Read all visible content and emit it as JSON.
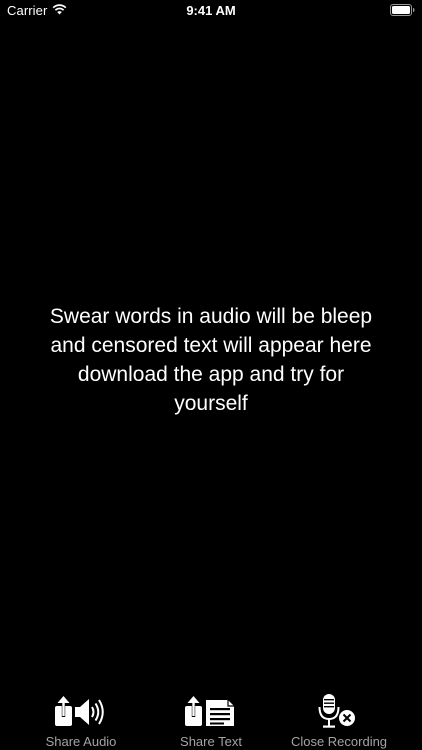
{
  "status_bar": {
    "carrier": "Carrier",
    "time": "9:41 AM",
    "wifi_icon": "wifi-icon",
    "battery_icon": "battery-full-icon"
  },
  "main": {
    "message": "Swear words in audio will be bleep\nand censored text will appear here\ndownload the app and try for\nyourself"
  },
  "toolbar": {
    "share_audio": {
      "label": "Share Audio",
      "icon": "share-audio-icon"
    },
    "share_text": {
      "label": "Share Text",
      "icon": "share-text-icon"
    },
    "close_recording": {
      "label": "Close Recording",
      "icon": "microphone-close-icon"
    }
  },
  "colors": {
    "background": "#000000",
    "text": "#ffffff",
    "toolbar_label": "#a3a3a3"
  }
}
